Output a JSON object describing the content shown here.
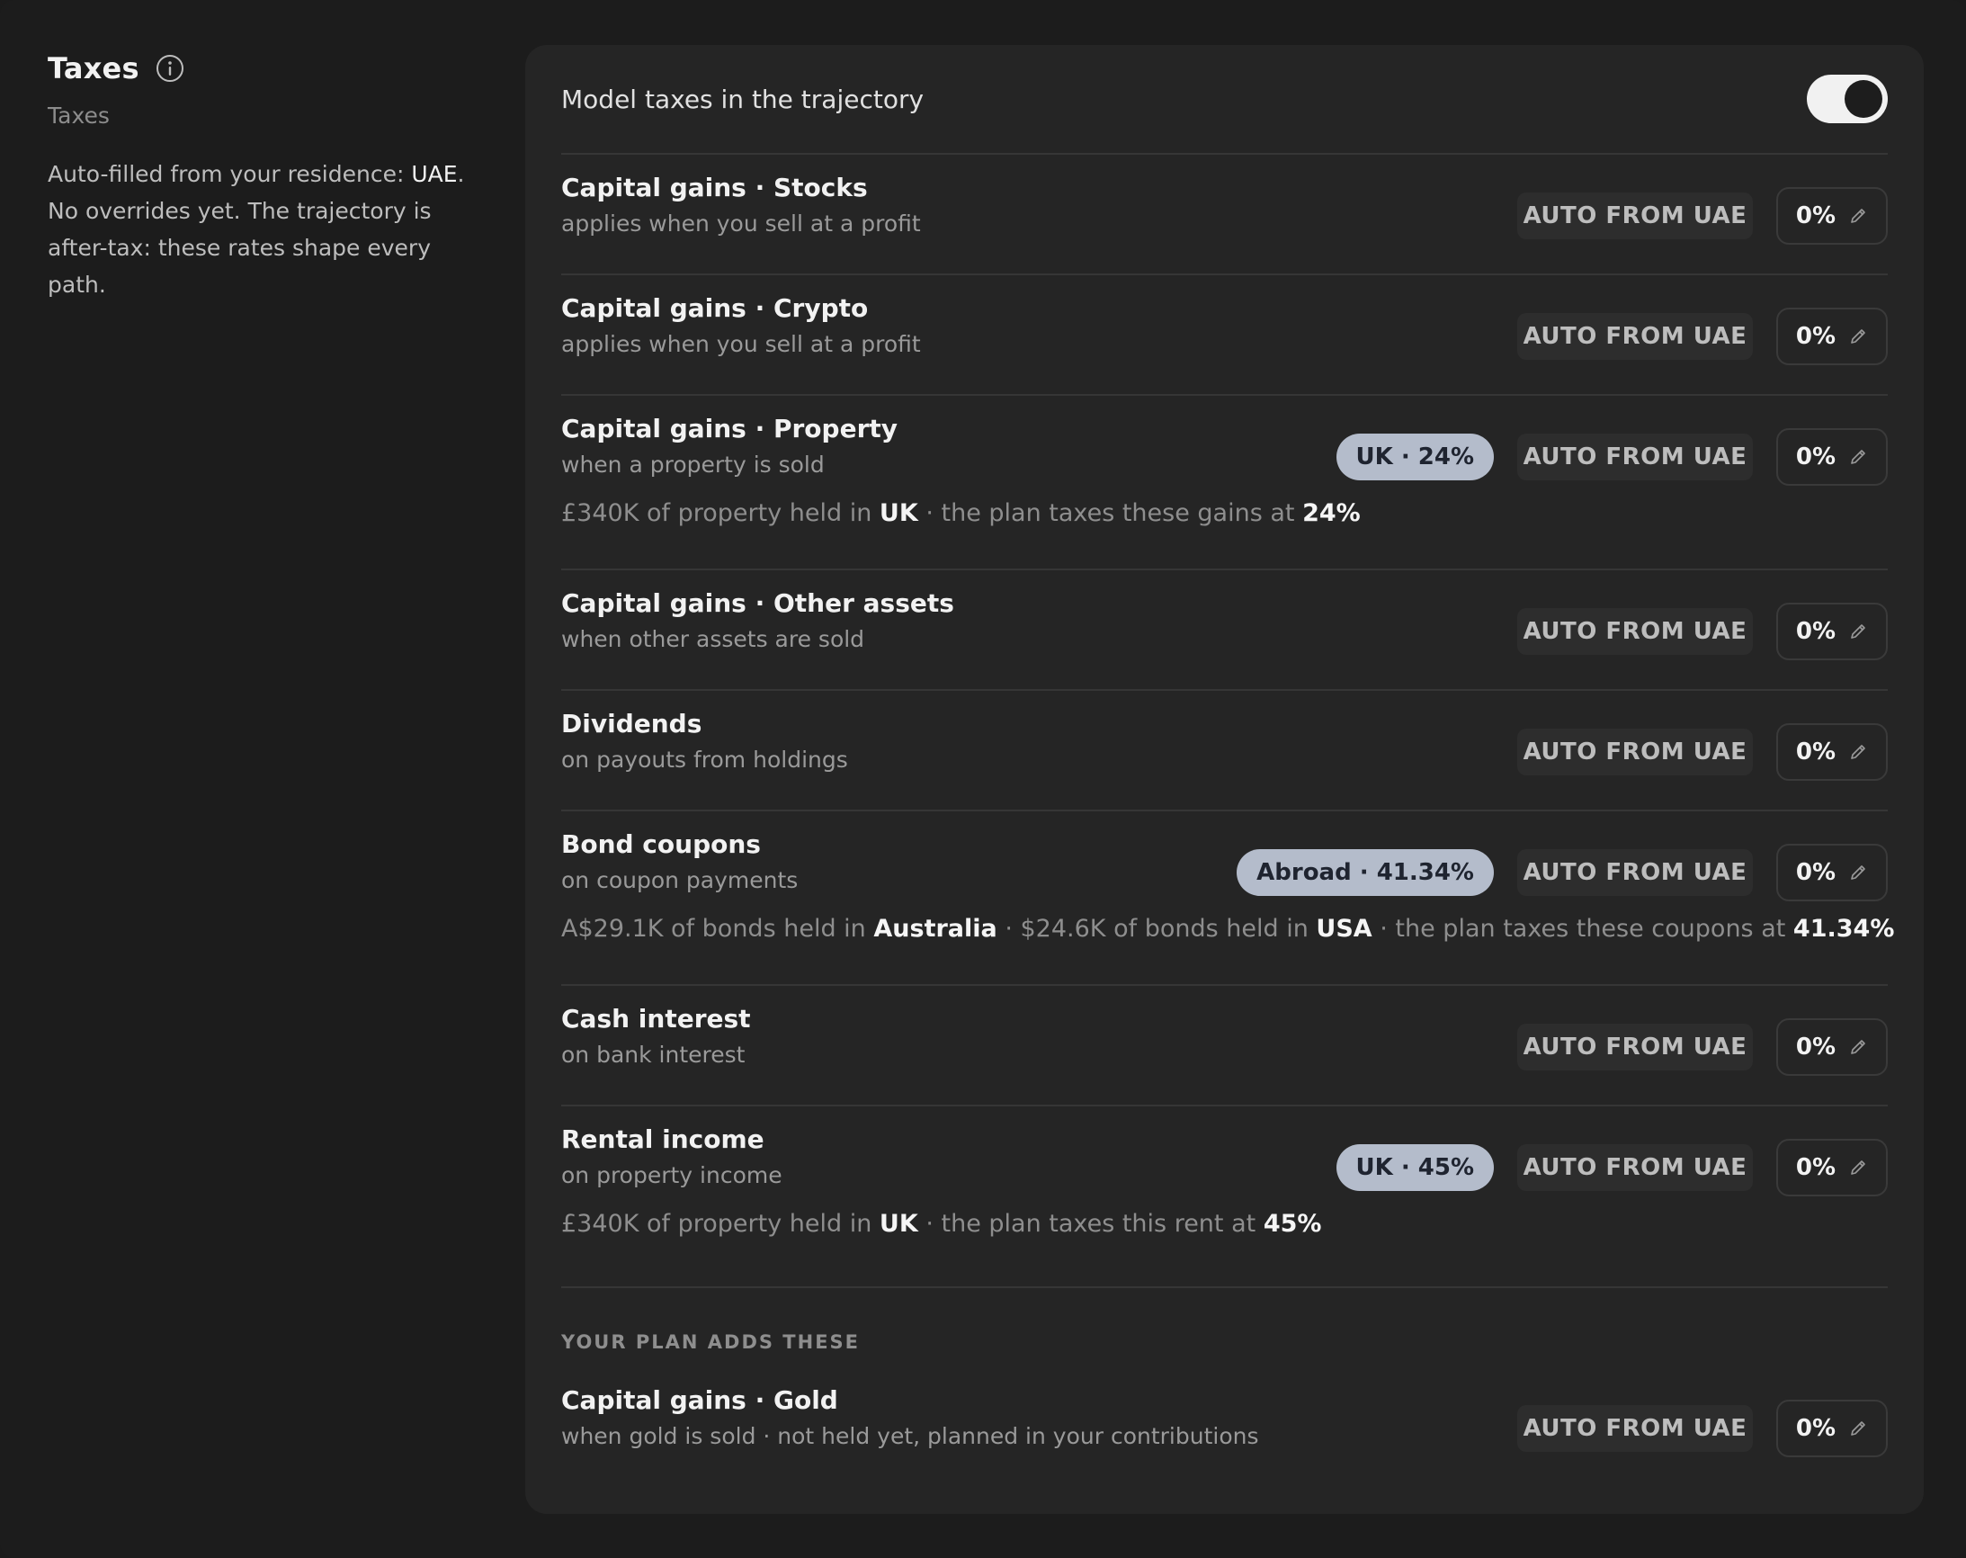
{
  "sidebar": {
    "title": "Taxes",
    "subtitle": "Taxes",
    "description_prefix": "Auto-filled from your residence: ",
    "residence": "UAE",
    "description_suffix": ". No overrides yet. The trajectory is after-tax: these rates shape every path."
  },
  "toggle": {
    "label": "Model taxes in the trajectory",
    "state": "on"
  },
  "rows": [
    {
      "title": "Capital gains · Stocks",
      "subtitle": "applies when you sell at a profit",
      "auto_label": "AUTO FROM UAE",
      "rate": "0%"
    },
    {
      "title": "Capital gains · Crypto",
      "subtitle": "applies when you sell at a profit",
      "auto_label": "AUTO FROM UAE",
      "rate": "0%"
    },
    {
      "title": "Capital gains · Property",
      "subtitle": "when a property is sold",
      "chip": "UK · 24%",
      "auto_label": "AUTO FROM UAE",
      "rate": "0%",
      "note": {
        "part1": "£340K of property held in ",
        "country": "UK",
        "part2": " · the plan taxes these gains at ",
        "rate": "24%"
      }
    },
    {
      "title": "Capital gains · Other assets",
      "subtitle": "when other assets are sold",
      "auto_label": "AUTO FROM UAE",
      "rate": "0%"
    },
    {
      "title": "Dividends",
      "subtitle": "on payouts from holdings",
      "auto_label": "AUTO FROM UAE",
      "rate": "0%"
    },
    {
      "title": "Bond coupons",
      "subtitle": "on coupon payments",
      "chip": "Abroad · 41.34%",
      "auto_label": "AUTO FROM UAE",
      "rate": "0%",
      "note": {
        "part1": "A$29.1K of bonds held in ",
        "country1": "Australia",
        "part2": " · $24.6K of bonds held in ",
        "country2": "USA",
        "part3": " · the plan taxes these coupons at ",
        "rate": "41.34%"
      }
    },
    {
      "title": "Cash interest",
      "subtitle": "on bank interest",
      "auto_label": "AUTO FROM UAE",
      "rate": "0%"
    },
    {
      "title": "Rental income",
      "subtitle": "on property income",
      "chip": "UK · 45%",
      "auto_label": "AUTO FROM UAE",
      "rate": "0%",
      "note": {
        "part1": "£340K of property held in ",
        "country": "UK",
        "part2": " · the plan taxes this rent at ",
        "rate": "45%"
      }
    }
  ],
  "plan_section": {
    "label": "YOUR PLAN ADDS THESE",
    "rows": [
      {
        "title": "Capital gains · Gold",
        "subtitle": "when gold is sold · not held yet, planned in your contributions",
        "auto_label": "AUTO FROM UAE",
        "rate": "0%"
      }
    ]
  },
  "icons": {
    "info": "info-icon",
    "edit": "pencil-icon"
  },
  "colors": {
    "chip_bg": "#b4bccb",
    "panel_bg": "#252525",
    "page_bg": "#1c1c1c"
  }
}
